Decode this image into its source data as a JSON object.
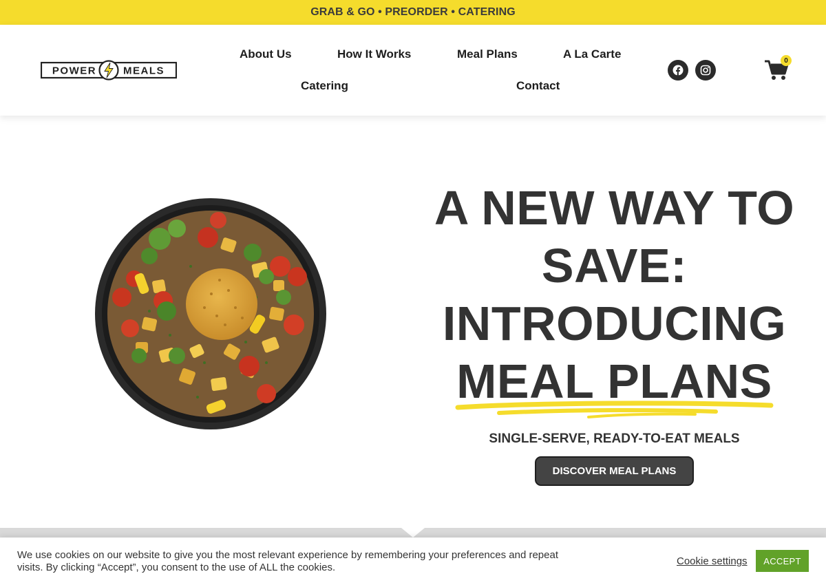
{
  "announcement": {
    "text": "GRAB & GO • PREORDER • CATERING"
  },
  "brand": {
    "word_left": "POWER",
    "word_right": "MEALS",
    "accent": "#f5dc2c"
  },
  "nav": {
    "items": [
      {
        "label": "About Us"
      },
      {
        "label": "How It Works"
      },
      {
        "label": "Meal Plans"
      },
      {
        "label": "A La Carte"
      },
      {
        "label": "Catering"
      },
      {
        "label": "Contact"
      }
    ]
  },
  "social": {
    "icons": [
      "facebook-icon",
      "instagram-icon"
    ]
  },
  "cart": {
    "icon": "cart-icon",
    "count": "0"
  },
  "hero": {
    "headline_lines": [
      "A NEW WAY TO",
      "SAVE:",
      "INTRODUCING",
      "MEAL PLANS"
    ],
    "subheading": "SINGLE-SERVE, READY-TO-EAT MEALS",
    "cta_label": "DISCOVER MEAL PLANS",
    "image_icon": "meal-bowl-image"
  },
  "cookie_banner": {
    "message": "We use cookies on our website to give you the most relevant experience by remembering your preferences and repeat visits. By clicking “Accept”, you consent to the use of ALL the cookies.",
    "settings_label": "Cookie settings",
    "accept_label": "ACCEPT",
    "accept_color": "#61a229"
  },
  "colors": {
    "topbar": "#f5dc2c",
    "text": "#333333",
    "button": "#444444"
  }
}
